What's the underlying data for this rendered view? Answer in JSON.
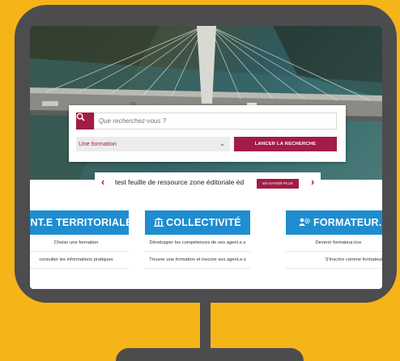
{
  "search": {
    "placeholder": "Que recherchez-vous ?",
    "select_value": "Une formation",
    "button_label": "LANCER LA RECHERCHE"
  },
  "carousel": {
    "text": "test feuille de ressource zone éditoriale éd",
    "more_label": "EN SAVOIR PLUS"
  },
  "cards": [
    {
      "title": "ENT.E TERRITORIALE",
      "links": [
        "Choisir une formation",
        "consulter les informations pratiques"
      ]
    },
    {
      "title": "COLLECTIVITÉ",
      "icon": "building-icon",
      "links": [
        "Développer les compétences de ses agent.e.s",
        "Trouver une formation et inscrire ses agent.e.s"
      ]
    },
    {
      "title": "FORMATEUR.R",
      "icon": "people-gear-icon",
      "links": [
        "Devenir formateur.rice",
        "S'inscrire comme formateur.ri"
      ]
    }
  ],
  "colors": {
    "background": "#f5b519",
    "monitor": "#4d4c4e",
    "accent": "#a31c45",
    "card_header": "#1f8dd0"
  }
}
